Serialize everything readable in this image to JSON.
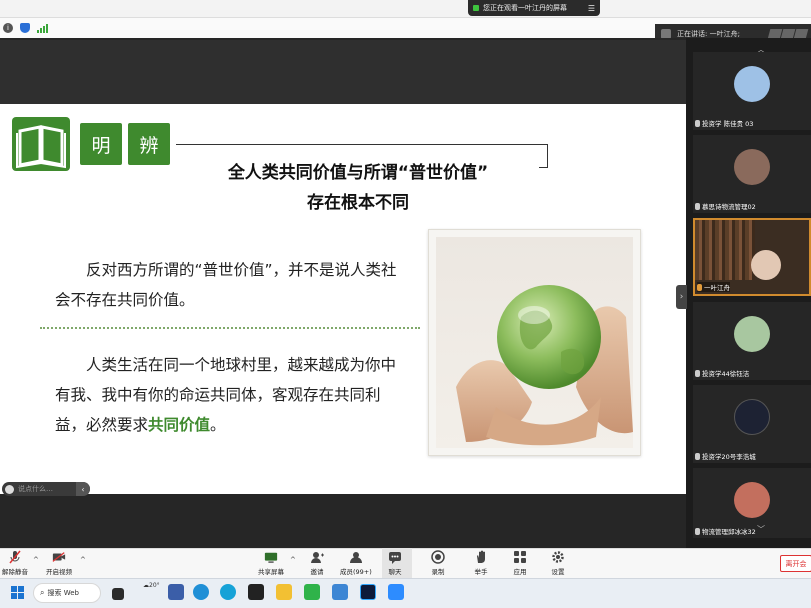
{
  "top_banner": {
    "viewing_text": "您正在观看一叶江丹的屏幕",
    "menu_glyph": "☰"
  },
  "speaker": {
    "label": "正在讲话: 一叶江舟;"
  },
  "slide": {
    "tag_left": "明",
    "tag_right": "辨",
    "title_line1": "全人类共同价值与所谓“普世价值”",
    "title_line2": "存在根本不同",
    "para1": "反对西方所谓的“普世价值”，并不是说人类社会不存在共同价值。",
    "para2_main": "人类生活在同一个地球村里，越来越成为你中有我、我中有你的命运共同体，客观存在共同利益，必然要求",
    "para2_highlight": "共同价值",
    "para2_end": "。"
  },
  "reaction": {
    "placeholder": "说点什么…",
    "arrow": "‹"
  },
  "participants": [
    {
      "name": "投资学 陈佳贵 03",
      "active": false,
      "avatar_color": "#9ec1e6"
    },
    {
      "name": "慕思诗物流管理02",
      "active": false,
      "avatar_color": "#8a6a5c"
    },
    {
      "name": "一叶江舟",
      "active": true,
      "avatar_color": "#6b4d33"
    },
    {
      "name": "投资学44徐钰洁",
      "active": false,
      "avatar_color": "#a8c7a0"
    },
    {
      "name": "投资学20号李浩城",
      "active": false,
      "avatar_color": "#1d2233"
    },
    {
      "name": "物流管理邱冰冰32",
      "active": false,
      "avatar_color": "#c36f5e"
    }
  ],
  "toolbar": {
    "mute": "解除静音",
    "video": "开启视频",
    "share": "共享屏幕",
    "invite": "邀请",
    "members": "成员(99+)",
    "chat": "聊天",
    "record": "录制",
    "raise_hand": "举手",
    "apps": "应用",
    "settings": "设置",
    "leave": "离开会"
  },
  "taskbar": {
    "search": "搜索 Web",
    "weather": "20°"
  },
  "colors": {
    "accent_green": "#3f8a2e",
    "leave_red": "#dd3333",
    "active_border": "#d18b2e"
  }
}
